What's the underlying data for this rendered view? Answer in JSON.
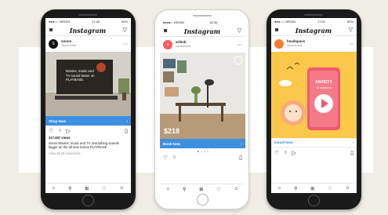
{
  "phones": [
    {
      "status": {
        "carrier": "●●●○○ VIRGIN",
        "time": "17:45",
        "battery": "90%"
      },
      "app_title": "Instagram",
      "account": {
        "name": "sonos",
        "sponsored": "Sponsored",
        "initial": "S"
      },
      "media_text": "Movies, music and TV sound better on PLAYBASE.",
      "cta": "Shop Now",
      "views": "317,487 views",
      "caption": "sonos Movies, music and TV. Everything sounds bigger on the all new Sonos PLAYBASE.",
      "comments": "View all 18 comments"
    },
    {
      "status": {
        "carrier": "●●●●○ VIRGIN",
        "time": "18:36",
        "battery": ""
      },
      "app_title": "Instagram",
      "account": {
        "name": "airbnb",
        "sponsored": "Sponsored",
        "initial": "a"
      },
      "price": "$218",
      "cta": "Book Now"
    },
    {
      "status": {
        "carrier": "●●●○○ VIRGIN",
        "time": "17:51",
        "battery": "80%"
      },
      "app_title": "Instagram",
      "account": {
        "name": "headspace",
        "sponsored": "Sponsored",
        "initial": ""
      },
      "media_title": "ANXIETY",
      "media_sub": "10 sessions",
      "cta": "Install Now"
    }
  ],
  "icons": {
    "camera": "camera-icon",
    "send": "send-icon",
    "heart": "heart-icon",
    "comment": "comment-icon",
    "bookmark": "bookmark-icon",
    "home": "home-icon",
    "search": "search-icon",
    "add": "add-icon",
    "profile": "profile-icon"
  },
  "colors": {
    "cta_blue": "#3d8fe0",
    "airbnb": "#ff5a5f",
    "headspace": "#f47d31",
    "headspace_bg": "#fcc84a"
  }
}
